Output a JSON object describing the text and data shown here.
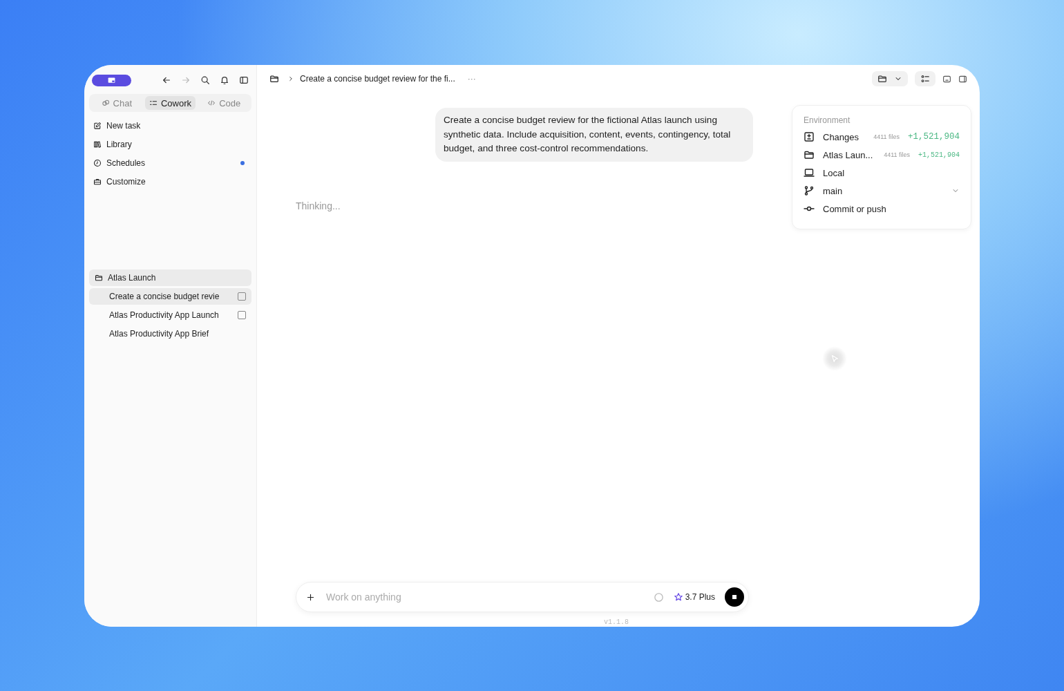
{
  "sidebar": {
    "tabs": [
      {
        "label": "Chat",
        "selected": false
      },
      {
        "label": "Cowork",
        "selected": true
      },
      {
        "label": "Code",
        "selected": false
      }
    ],
    "nav": [
      {
        "label": "New task",
        "unread": false
      },
      {
        "label": "Library",
        "unread": false
      },
      {
        "label": "Schedules",
        "unread": true
      },
      {
        "label": "Customize",
        "unread": false
      }
    ],
    "project": {
      "name": "Atlas Launch",
      "tasks": [
        {
          "title": "Create a concise budget revie",
          "selected": true,
          "kind": "checkbox"
        },
        {
          "title": "Atlas Productivity App Launch",
          "selected": false,
          "kind": "checkbox"
        },
        {
          "title": "Atlas Productivity App Brief",
          "selected": false,
          "kind": "plain"
        }
      ]
    }
  },
  "breadcrumb": {
    "title": "Create a concise budget review for the fi...",
    "more": "···"
  },
  "message": "Create a concise budget review for the fictional Atlas launch using synthetic data. Include acquisition, content, events, contingency, total budget, and three cost-control recommendations.",
  "status": "Thinking...",
  "environment": {
    "title": "Environment",
    "rows": [
      {
        "label": "Changes",
        "files": "4411 files",
        "additions": "+1,521,904"
      },
      {
        "label": "Atlas Laun...",
        "files": "4411 files",
        "additions": "+1,521,904"
      },
      {
        "label": "Local"
      },
      {
        "label": "main",
        "dropdown": true
      },
      {
        "label": "Commit or push"
      }
    ]
  },
  "composer": {
    "placeholder": "Work on anything",
    "model": "3.7 Plus"
  },
  "version": "v1.1.8"
}
